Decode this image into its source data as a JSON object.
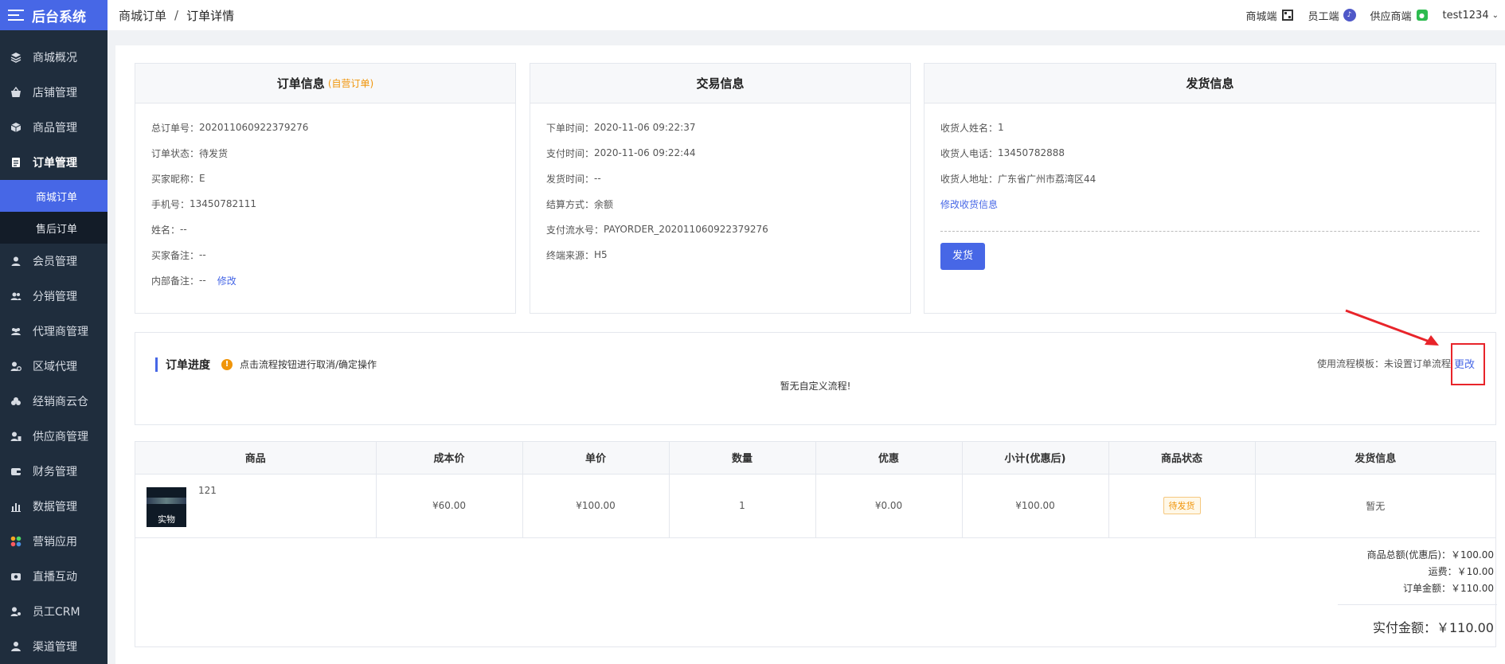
{
  "sidebar": {
    "brand": "后台系统",
    "items": [
      {
        "label": "商城概况",
        "icon": "layers-icon"
      },
      {
        "label": "店铺管理",
        "icon": "basket-icon"
      },
      {
        "label": "商品管理",
        "icon": "cube-icon"
      },
      {
        "label": "订单管理",
        "icon": "order-icon"
      },
      {
        "label": "会员管理",
        "icon": "user-icon"
      },
      {
        "label": "分销管理",
        "icon": "users-icon"
      },
      {
        "label": "代理商管理",
        "icon": "agent-icon"
      },
      {
        "label": "区域代理",
        "icon": "location-icon"
      },
      {
        "label": "经销商云仓",
        "icon": "cloud-icon"
      },
      {
        "label": "供应商管理",
        "icon": "supplier-icon"
      },
      {
        "label": "财务管理",
        "icon": "wallet-icon"
      },
      {
        "label": "数据管理",
        "icon": "bar-chart-icon"
      },
      {
        "label": "营销应用",
        "icon": "apps-icon"
      },
      {
        "label": "直播互动",
        "icon": "video-icon"
      },
      {
        "label": "员工CRM",
        "icon": "crm-icon"
      },
      {
        "label": "渠道管理",
        "icon": "channel-icon"
      }
    ],
    "sub_items": [
      {
        "label": "商城订单"
      },
      {
        "label": "售后订单"
      }
    ]
  },
  "header": {
    "breadcrumb": [
      "商城订单",
      "订单详情"
    ],
    "separator": "/",
    "right": {
      "mall": "商城端",
      "staff": "员工端",
      "supplier": "供应商端",
      "user": "test1234"
    }
  },
  "order_info": {
    "title": "订单信息",
    "tag": "(自营订单)",
    "rows": [
      {
        "label": "总订单号：",
        "value": "202011060922379276"
      },
      {
        "label": "订单状态：",
        "value": "待发货"
      },
      {
        "label": "买家昵称：",
        "value": "E"
      },
      {
        "label": "手机号：",
        "value": "13450782111"
      },
      {
        "label": "姓名：",
        "value": "--"
      },
      {
        "label": "买家备注：",
        "value": "--"
      },
      {
        "label": "内部备注：",
        "value": "--"
      }
    ],
    "edit_link": "修改"
  },
  "trade_info": {
    "title": "交易信息",
    "rows": [
      {
        "label": "下单时间：",
        "value": "2020-11-06 09:22:37"
      },
      {
        "label": "支付时间：",
        "value": "2020-11-06 09:22:44"
      },
      {
        "label": "发货时间：",
        "value": "--"
      },
      {
        "label": "结算方式：",
        "value": "余额"
      },
      {
        "label": "支付流水号：",
        "value": "PAYORDER_202011060922379276"
      },
      {
        "label": "终端来源：",
        "value": "H5"
      }
    ]
  },
  "delivery_info": {
    "title": "发货信息",
    "rows": [
      {
        "label": "收货人姓名：",
        "value": "1"
      },
      {
        "label": "收货人电话：",
        "value": "13450782888"
      },
      {
        "label": "收货人地址：",
        "value": "广东省广州市荔湾区44"
      }
    ],
    "edit_link": "修改收货信息",
    "ship_button": "发货"
  },
  "progress": {
    "title": "订单进度",
    "hint": "点击流程按钮进行取消/确定操作",
    "empty": "暂无自定义流程!",
    "template_label": "使用流程模板：未设置订单流程",
    "change_link": "更改"
  },
  "goods_table": {
    "headers": [
      "商品",
      "成本价",
      "单价",
      "数量",
      "优惠",
      "小计(优惠后)",
      "商品状态",
      "发货信息"
    ],
    "rows": [
      {
        "name": "121",
        "thumb_text": "实物",
        "cost": "¥60.00",
        "price": "¥100.00",
        "qty": "1",
        "discount": "¥0.00",
        "subtotal": "¥100.00",
        "status": "待发货",
        "delivery": "暂无"
      }
    ]
  },
  "totals": {
    "goods_total": "商品总额(优惠后)：￥100.00",
    "freight": "运费：￥10.00",
    "order_amount": "订单金额：￥110.00",
    "paid": "实付金额：￥110.00"
  },
  "colors": {
    "primary": "#4767e6",
    "sidebar_bg": "#1f2d3d",
    "warn": "#f0950a",
    "annotation_red": "#e8242a"
  }
}
